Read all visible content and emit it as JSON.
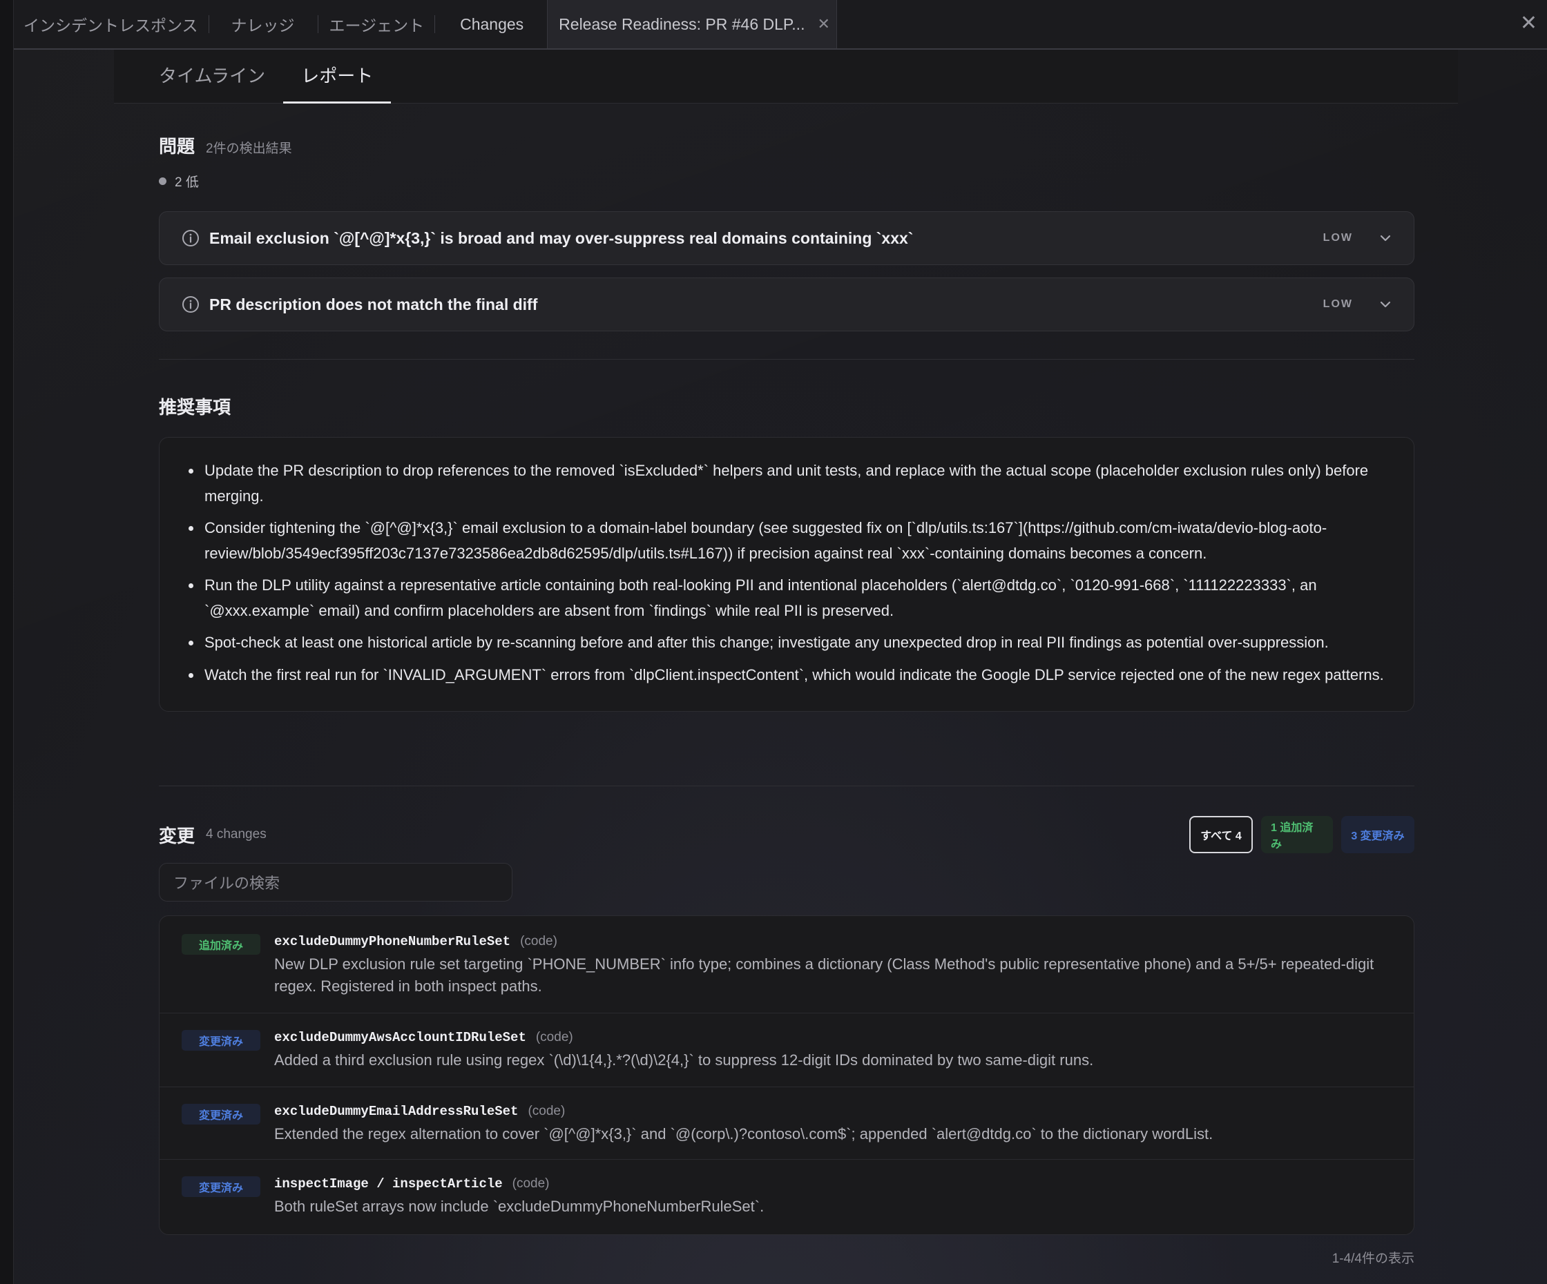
{
  "tabs": [
    {
      "label": "インシデントレスポンス"
    },
    {
      "label": "ナレッジ"
    },
    {
      "label": "エージェント"
    },
    {
      "label": "Changes"
    },
    {
      "label": "Release Readiness: PR #46 DLP..."
    }
  ],
  "subtabs": [
    {
      "label": "タイムライン"
    },
    {
      "label": "レポート"
    }
  ],
  "issues": {
    "title": "問題",
    "subtitle": "2件の検出結果",
    "summary": "2 低",
    "items": [
      {
        "title": "Email exclusion `@[^@]*x{3,}` is broad and may over-suppress real domains containing `xxx`",
        "severity": "LOW"
      },
      {
        "title": "PR description does not match the final diff",
        "severity": "LOW"
      }
    ]
  },
  "recommendations": {
    "title": "推奨事項",
    "items": [
      "Update the PR description to drop references to the removed `isExcluded*` helpers and unit tests, and replace with the actual scope (placeholder exclusion rules only) before merging.",
      "Consider tightening the `@[^@]*x{3,}` email exclusion to a domain-label boundary (see suggested fix on [`dlp/utils.ts:167`](https://github.com/cm-iwata/devio-blog-aoto-review/blob/3549ecf395ff203c7137e7323586ea2db8d62595/dlp/utils.ts#L167)) if precision against real `xxx`-containing domains becomes a concern.",
      "Run the DLP utility against a representative article containing both real-looking PII and intentional placeholders (`alert@dtdg.co`, `0120-991-668`, `111122223333`, an `@xxx.example` email) and confirm placeholders are absent from `findings` while real PII is preserved.",
      "Spot-check at least one historical article by re-scanning before and after this change; investigate any unexpected drop in real PII findings as potential over-suppression.",
      "Watch the first real run for `INVALID_ARGUMENT` errors from `dlpClient.inspectContent`, which would indicate the Google DLP service rejected one of the new regex patterns."
    ]
  },
  "changes": {
    "title": "変更",
    "subtitle": "4 changes",
    "filters": {
      "all": "すべて 4",
      "added": "1 追加済み",
      "modified": "3 変更済み"
    },
    "search_placeholder": "ファイルの検索",
    "items": [
      {
        "status": "追加済み",
        "status_type": "added",
        "name": "excludeDummyPhoneNumberRuleSet",
        "kind": "(code)",
        "description": "New DLP exclusion rule set targeting `PHONE_NUMBER` info type; combines a dictionary (Class Method's public representative phone) and a 5+/5+ repeated-digit regex. Registered in both inspect paths."
      },
      {
        "status": "変更済み",
        "status_type": "modified",
        "name": "excludeDummyAwsAcclountIDRuleSet",
        "kind": "(code)",
        "description": "Added a third exclusion rule using regex `(\\d)\\1{4,}.*?(\\d)\\2{4,}` to suppress 12-digit IDs dominated by two same-digit runs."
      },
      {
        "status": "変更済み",
        "status_type": "modified",
        "name": "excludeDummyEmailAddressRuleSet",
        "kind": "(code)",
        "description": "Extended the regex alternation to cover `@[^@]*x{3,}` and `@(corp\\.)?contoso\\.com$`; appended `alert@dtdg.co` to the dictionary wordList."
      },
      {
        "status": "変更済み",
        "status_type": "modified",
        "name": "inspectImage / inspectArticle",
        "kind": "(code)",
        "description": "Both ruleSet arrays now include `excludeDummyPhoneNumberRuleSet`."
      }
    ],
    "pagination": "1-4/4件の表示"
  },
  "colors": {
    "added": "#4fbf72",
    "modified": "#4f7fe0",
    "background": "#1d1d22"
  }
}
